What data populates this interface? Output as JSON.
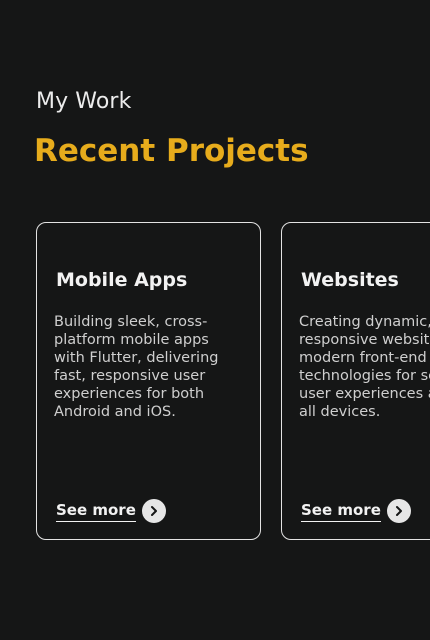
{
  "section": {
    "eyebrow": "My Work",
    "heading": "Recent Projects"
  },
  "colors": {
    "background": "#151616",
    "accent": "#e7ac1c",
    "card_border": "#e3e3e3"
  },
  "cards": [
    {
      "title": "Mobile Apps",
      "description": "Building sleek, cross-platform mobile apps with Flutter, delivering fast, responsive user experiences for both Android and iOS.",
      "link_label": "See more",
      "link_icon": "chevron-right-icon"
    },
    {
      "title": "Websites",
      "description": "Creating dynamic, responsive websites with modern front-end technologies for seamless user experiences across all devices.",
      "link_label": "See more",
      "link_icon": "chevron-right-icon"
    }
  ]
}
